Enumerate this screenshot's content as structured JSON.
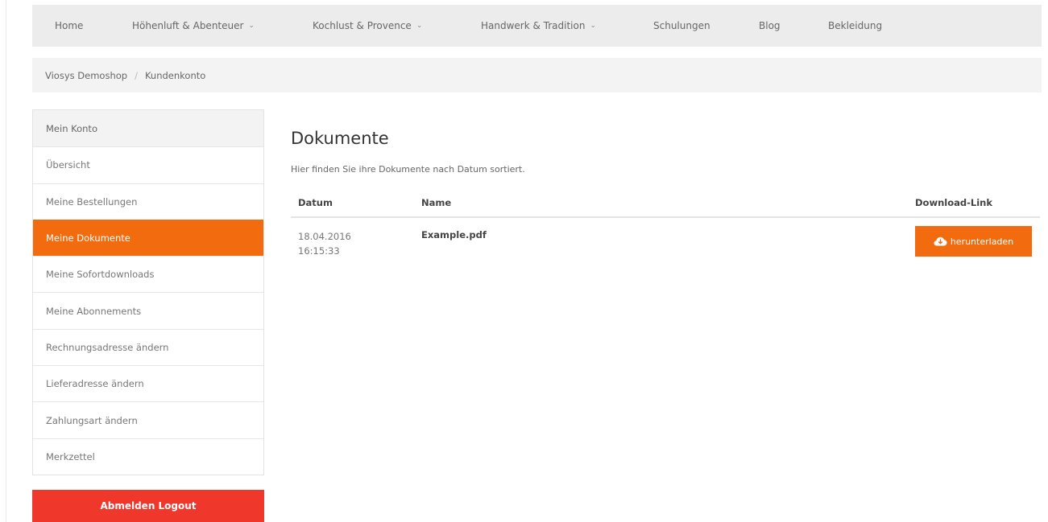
{
  "nav": {
    "items": [
      {
        "label": "Home",
        "has_dropdown": false
      },
      {
        "label": "Höhenluft & Abenteuer",
        "has_dropdown": true
      },
      {
        "label": "Kochlust & Provence",
        "has_dropdown": true
      },
      {
        "label": "Handwerk & Tradition",
        "has_dropdown": true
      },
      {
        "label": "Schulungen",
        "has_dropdown": false
      },
      {
        "label": "Blog",
        "has_dropdown": false
      },
      {
        "label": "Bekleidung",
        "has_dropdown": false
      }
    ],
    "dropdown_glyph": "⌄"
  },
  "breadcrumb": {
    "items": [
      "Viosys Demoshop",
      "Kundenkonto"
    ],
    "separator": "/"
  },
  "sidebar": {
    "items": [
      {
        "label": "Mein Konto"
      },
      {
        "label": "Übersicht"
      },
      {
        "label": "Meine Bestellungen"
      },
      {
        "label": "Meine Dokumente",
        "active": true
      },
      {
        "label": "Meine Sofortdownloads"
      },
      {
        "label": "Meine Abonnements"
      },
      {
        "label": "Rechnungsadresse ändern"
      },
      {
        "label": "Lieferadresse ändern"
      },
      {
        "label": "Zahlungsart ändern"
      },
      {
        "label": "Merkzettel"
      }
    ],
    "logout_label": "Abmelden Logout"
  },
  "main": {
    "title": "Dokumente",
    "description": "Hier finden Sie ihre Dokumente nach Datum sortiert.",
    "table": {
      "headers": {
        "date": "Datum",
        "name": "Name",
        "download": "Download-Link"
      },
      "rows": [
        {
          "date": "18.04.2016",
          "time": "16:15:33",
          "name": "Example.pdf",
          "download_label": "herunterladen"
        }
      ]
    }
  },
  "colors": {
    "accent": "#f26b0f",
    "logout": "#f0372c",
    "nav_bg": "#ececec"
  },
  "icons": {
    "download": "cloud-download-icon",
    "dropdown": "chevron-down-icon"
  }
}
